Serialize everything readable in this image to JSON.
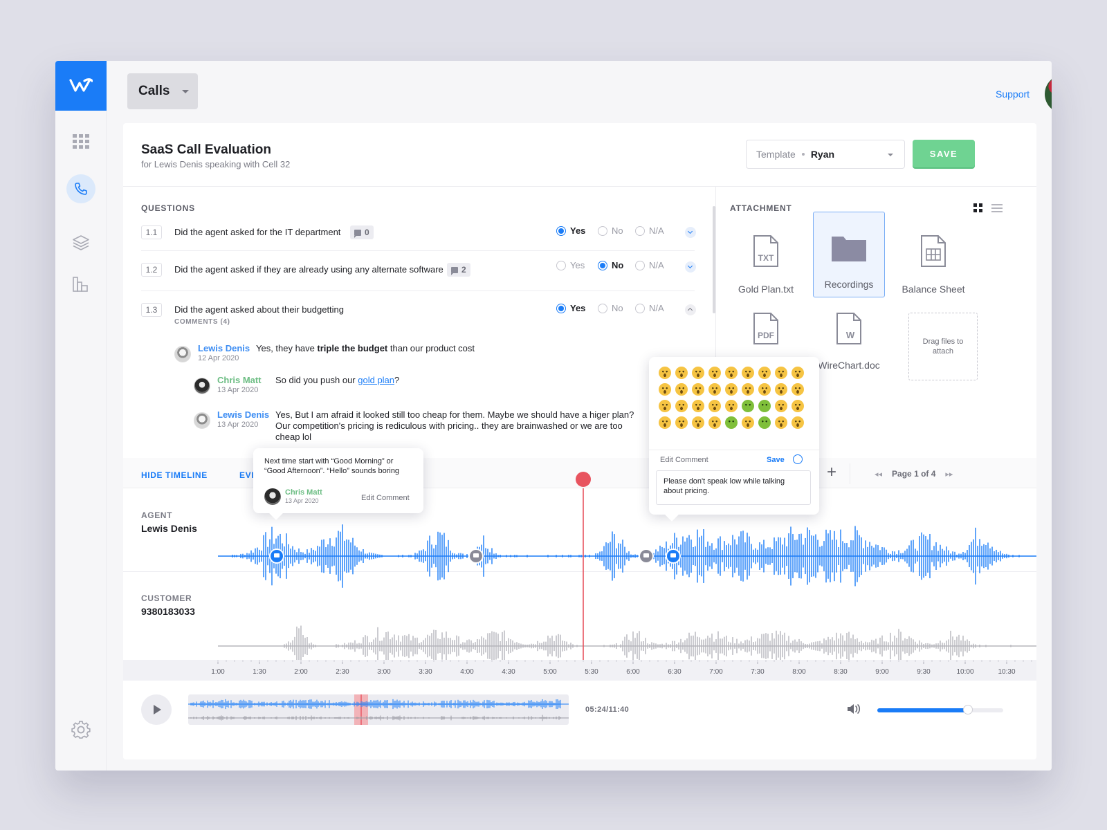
{
  "topbar": {
    "section": "Calls",
    "support": "Support"
  },
  "header": {
    "title": "SaaS Call Evaluation",
    "subtitle": "for Lewis Denis speaking with Cell 32",
    "template_label": "Template",
    "template_value": "Ryan",
    "save_label": "SAVE"
  },
  "questions": {
    "label": "QUESTIONS",
    "items": [
      {
        "num": "1.1",
        "text": "Did the agent asked for the IT department",
        "comments": "0",
        "answer": "Yes"
      },
      {
        "num": "1.2",
        "text": "Did the agent asked if they are already using any alternate software",
        "comments": "2",
        "answer": "No"
      },
      {
        "num": "1.3",
        "text": "Did the agent asked about their budgetting",
        "answer": "Yes"
      }
    ],
    "options": [
      "Yes",
      "No",
      "N/A"
    ],
    "comments_label": "COMMENTS (4)",
    "comments": [
      {
        "name": "Lewis Denis",
        "date": "12 Apr 2020",
        "pre": "Yes, they have ",
        "bold": "triple the budget",
        "post": " than our product cost"
      },
      {
        "name": "Chris Matt",
        "date": "13 Apr 2020",
        "pre": "So did you push our ",
        "link": "gold plan",
        "post": "?"
      },
      {
        "name": "Lewis Denis",
        "date": "13 Apr 2020",
        "text": "Yes, But I am afraid it looked still too cheap for them. Maybe we should have a higer plan? Our competition's  pricing is rediculous with pricing.. they are brainwashed or we are too cheap lol"
      }
    ]
  },
  "attachment": {
    "label": "ATTACHMENT",
    "files": [
      {
        "name": "Gold Plan.txt",
        "tag": "TXT"
      },
      {
        "name": "Recordings"
      },
      {
        "name": "Balance Sheet"
      },
      {
        "name": "",
        "tag": "PDF"
      },
      {
        "name": "WireChart.doc",
        "tag": "W"
      }
    ],
    "drop_text": "Drag files to attach"
  },
  "timeline": {
    "hide": "HIDE TIMELINE",
    "events": "EVI",
    "page": "Page 1 of 4",
    "agent_role": "AGENT",
    "agent_name": "Lewis Denis",
    "customer_role": "CUSTOMER",
    "customer_name": "9380183033",
    "ticks": [
      "1:00",
      "1:30",
      "2:00",
      "2:30",
      "3:00",
      "3:30",
      "4:00",
      "4:30",
      "5:00",
      "5:30",
      "6:00",
      "6:30",
      "7:00",
      "7:30",
      "8:00",
      "8:30",
      "9:00",
      "9:30",
      "10:00",
      "10:30"
    ],
    "playhead": "5:24",
    "time_readout": "05:24/11:40",
    "volume": 0.72
  },
  "bubble_comment": {
    "text": "Next time start with “Good Morning” or “Good Afternoon”.  “Hello” sounds boring",
    "name": "Chris Matt",
    "date": "13 Apr 2020",
    "edit": "Edit Comment"
  },
  "bubble_edit": {
    "label": "Edit Comment",
    "save": "Save",
    "text": "Please don't speak low while talking about pricing."
  },
  "colors": {
    "accent": "#1a7cf7",
    "save": "#6fd392",
    "playhead": "#e8545f",
    "customer_wave": "#b5b5bb"
  }
}
